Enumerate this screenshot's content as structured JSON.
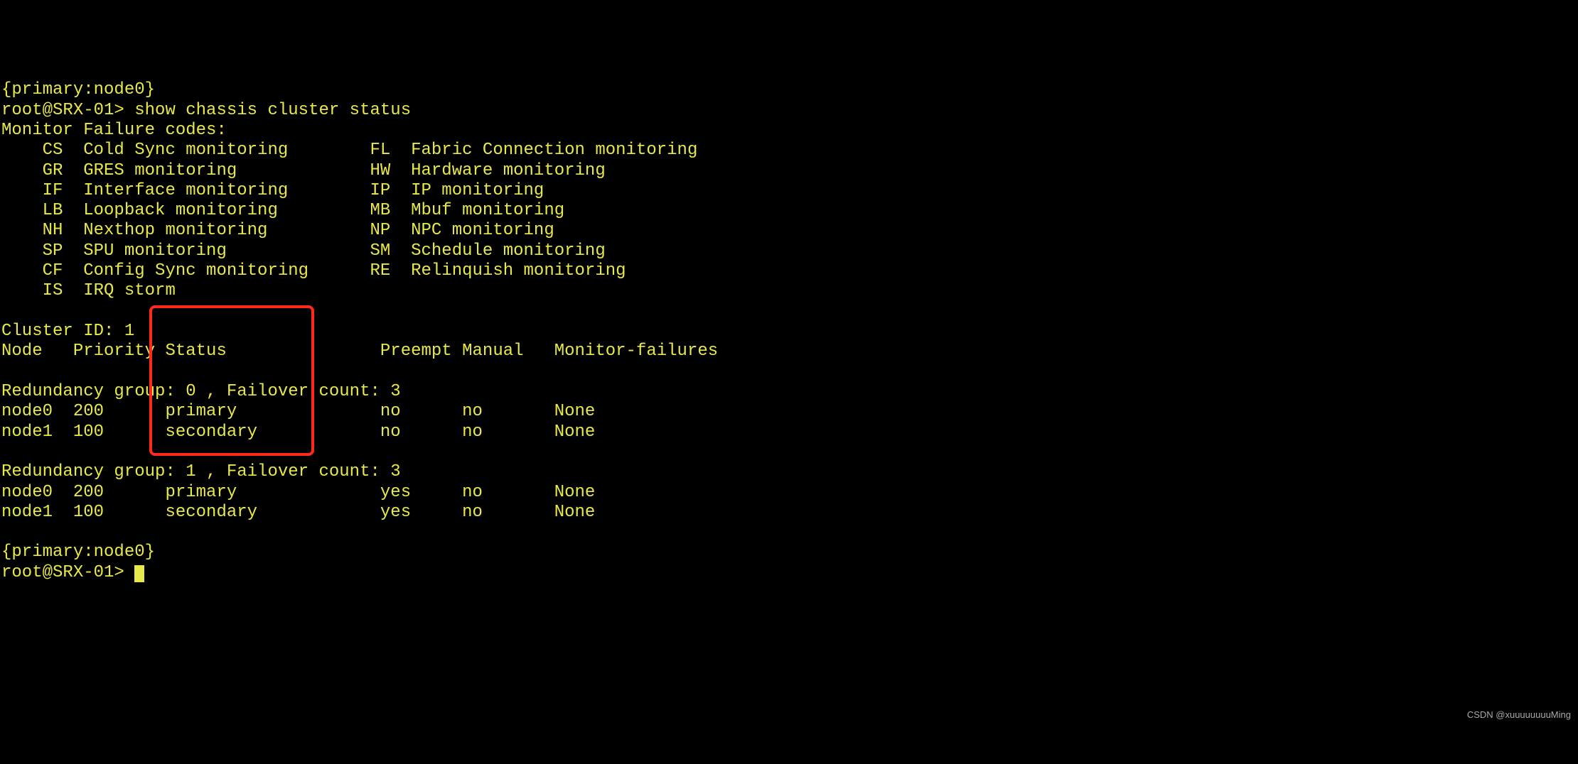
{
  "terminal": {
    "line_top_context": "{primary:node0}",
    "prompt1": "root@SRX-01> ",
    "command": "show chassis cluster status",
    "failure_header": "Monitor Failure codes:",
    "codes": [
      "    CS  Cold Sync monitoring        FL  Fabric Connection monitoring",
      "    GR  GRES monitoring             HW  Hardware monitoring",
      "    IF  Interface monitoring        IP  IP monitoring",
      "    LB  Loopback monitoring         MB  Mbuf monitoring",
      "    NH  Nexthop monitoring          NP  NPC monitoring",
      "    SP  SPU monitoring              SM  Schedule monitoring",
      "    CF  Config Sync monitoring      RE  Relinquish monitoring",
      "    IS  IRQ storm"
    ],
    "cluster_id": "Cluster ID: 1",
    "columns": "Node   Priority Status               Preempt Manual   Monitor-failures",
    "rg0_header": "Redundancy group: 0 , Failover count: 3",
    "rg0_rows": [
      "node0  200      primary              no      no       None",
      "node1  100      secondary            no      no       None"
    ],
    "rg1_header": "Redundancy group: 1 , Failover count: 3",
    "rg1_rows": [
      "node0  200      primary              yes     no       None",
      "node1  100      secondary            yes     no       None"
    ],
    "context_end": "{primary:node0}",
    "prompt2": "root@SRX-01> "
  },
  "watermark": "CSDN @xuuuuuuuuMing"
}
